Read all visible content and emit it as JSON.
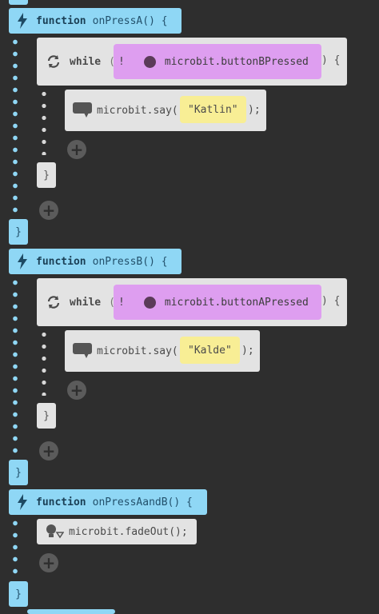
{
  "blocks": [
    {
      "keyword": "function",
      "name": "onPressA",
      "signature_suffix": "() {",
      "while_keyword": "while",
      "open_paren": "(",
      "not_operator": "!",
      "condition": "microbit.buttonBPressed",
      "close_brace_open": ") {",
      "say_call": "microbit.say(",
      "say_arg": "\"Katlin\"",
      "say_end": ");",
      "inner_close": "}",
      "close": "}"
    },
    {
      "keyword": "function",
      "name": "onPressB",
      "signature_suffix": "() {",
      "while_keyword": "while",
      "open_paren": "(",
      "not_operator": "!",
      "condition": "microbit.buttonAPressed",
      "close_brace_open": ") {",
      "say_call": "microbit.say(",
      "say_arg": "\"Kalde\"",
      "say_end": ");",
      "inner_close": "}",
      "close": "}"
    },
    {
      "keyword": "function",
      "name": "onPressAandB",
      "signature_suffix": "() {",
      "call": "microbit.fadeOut();",
      "close": "}"
    }
  ],
  "icons": {
    "function": "lightning-icon",
    "loop": "loop-arrows-icon",
    "say": "speech-bubble-icon",
    "fade": "lightbulb-fade-icon",
    "add": "plus-circle-icon"
  },
  "colors": {
    "background": "#2e2e2e",
    "function_block": "#8fd7f5",
    "statement_block": "#e3e3e3",
    "condition_block": "#de9ef0",
    "string_literal": "#f8ee95"
  }
}
